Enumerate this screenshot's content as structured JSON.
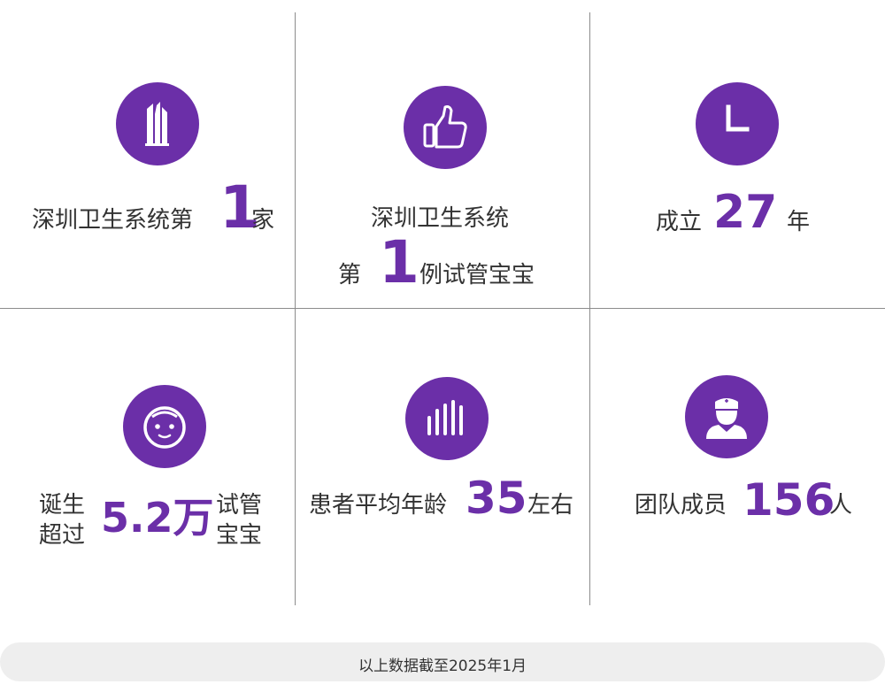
{
  "stats": [
    {
      "pre": "深圳卫生系统第",
      "num": "1",
      "post": "家"
    },
    {
      "line1": "深圳卫生系统",
      "pre": "第",
      "num": "1",
      "post": "例试管宝宝"
    },
    {
      "pre": "成立",
      "num": "27",
      "post": "年"
    },
    {
      "pre_line1": "诞生",
      "pre_line2": "超过",
      "num": "5.2万",
      "post_line1": "试管",
      "post_line2": "宝宝"
    },
    {
      "pre": "患者平均年龄",
      "num": "35",
      "post": "左右"
    },
    {
      "pre": "团队成员",
      "num": "156",
      "post": "人"
    }
  ],
  "icons": [
    "building-icon",
    "thumbs-up-icon",
    "clock-icon",
    "baby-face-icon",
    "bar-chart-icon",
    "doctor-icon"
  ],
  "colors": {
    "accent": "#6b2fa8",
    "text": "#333333",
    "divider": "#8c8c8c",
    "footer_bg": "#eeeeee"
  },
  "footer": {
    "note": "以上数据截至2025年1月"
  }
}
